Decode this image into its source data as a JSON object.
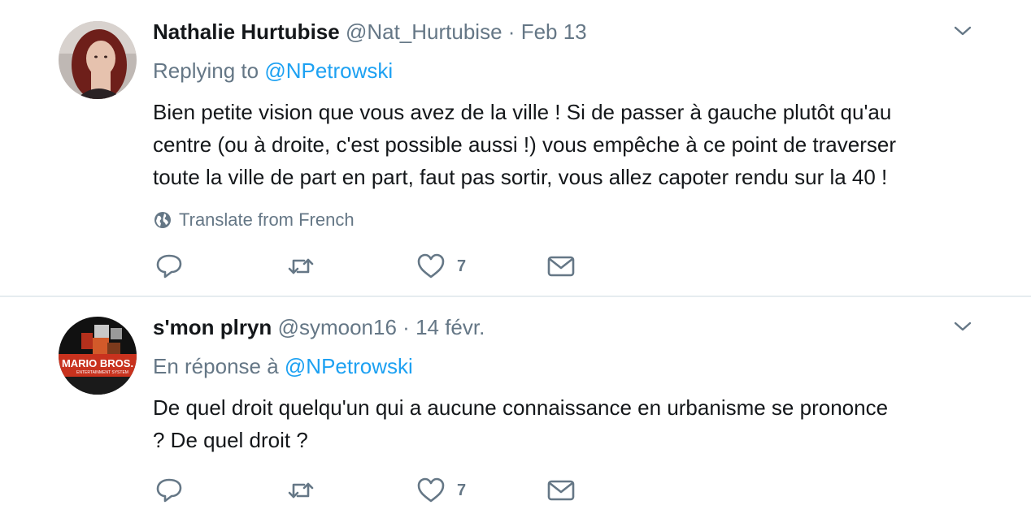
{
  "tweets": [
    {
      "name": "Nathalie Hurtubise",
      "handle": "@Nat_Hurtubise",
      "separator": "·",
      "date": "Feb 13",
      "reply_prefix": "Replying to",
      "reply_mention": "@NPetrowski",
      "text_lines": [
        "Bien petite vision que vous avez de la ville ! Si de passer à gauche plutôt qu'au",
        "centre (ou à droite, c'est possible aussi !) vous empêche à ce point de traverser",
        "toute la ville de part en part, faut pas sortir, vous allez capoter rendu sur la 40 !"
      ],
      "translate_label": "Translate from French",
      "like_count": "7",
      "icons": [
        "avatar-photo",
        "chevron-down-icon",
        "globe-icon",
        "reply-icon",
        "retweet-icon",
        "heart-icon",
        "envelope-icon"
      ]
    },
    {
      "name": "s'mon plryn",
      "handle": "@symoon16",
      "separator": "·",
      "date": "14 févr.",
      "reply_prefix": "En réponse à",
      "reply_mention": "@NPetrowski",
      "text_lines": [
        "De quel droit quelqu'un qui a aucune connaissance en urbanisme se prononce",
        "? De quel droit ?"
      ],
      "like_count": "7",
      "icons": [
        "avatar-mario-bros",
        "chevron-down-icon",
        "reply-icon",
        "retweet-icon",
        "heart-icon",
        "envelope-icon"
      ]
    }
  ],
  "colors": {
    "link": "#1da1f2",
    "secondary_text": "#657786",
    "primary_text": "#14171a",
    "divider": "#e6ecf0"
  }
}
